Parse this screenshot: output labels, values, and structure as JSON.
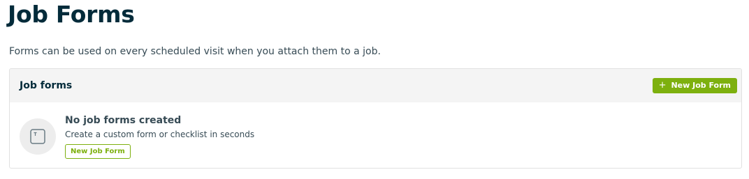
{
  "page": {
    "title": "Job Forms",
    "description": "Forms can be used on every scheduled visit when you attach them to a job."
  },
  "card": {
    "title": "Job forms",
    "new_button": {
      "icon": "plus-icon",
      "icon_glyph": "+",
      "label": "New Job Form"
    },
    "empty_state": {
      "icon": "text-field-icon",
      "title": "No job forms created",
      "subtitle": "Create a custom form or checklist in seconds",
      "button_label": "New Job Form"
    }
  },
  "colors": {
    "heading": "#032b3a",
    "body_text": "#374b55",
    "accent_green": "#7db00e",
    "header_bg": "#f4f4f4",
    "border": "#e1e1e1",
    "icon_circle_bg": "#ededed"
  }
}
